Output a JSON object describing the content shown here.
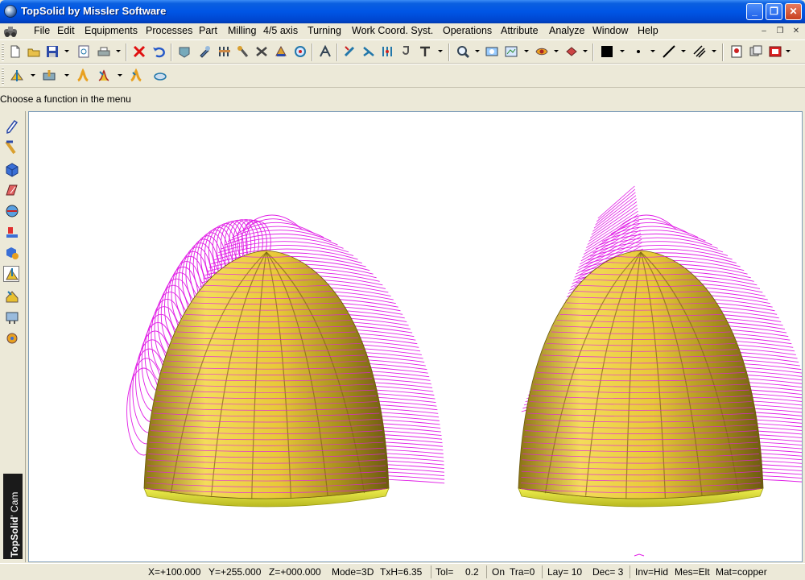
{
  "window": {
    "title": "TopSolid by Missler Software"
  },
  "menu": [
    "File",
    "Edit",
    "Equipments",
    "Processes",
    "Part",
    "Milling",
    "4/5 axis",
    "Turning",
    "Work Coord. Syst.",
    "Operations",
    "Attribute",
    "Analyze",
    "Window",
    "Help"
  ],
  "prompt": "Choose a function in the menu",
  "sidebar": {
    "brand": "TopSolid",
    "brand_suffix": "' Cam"
  },
  "status": {
    "x": "X=+100.000",
    "y": "Y=+255.000",
    "z": "Z=+000.000",
    "mode": "Mode=3D",
    "txh": "TxH=6.35",
    "tol_label": "Tol=",
    "tol_value": "0.2",
    "on": "On",
    "tra": "Tra=0",
    "lay": "Lay= 10",
    "dec": "Dec= 3",
    "inv": "Inv=Hid",
    "mes": "Mes=Elt",
    "mat": "Mat=copper"
  },
  "colors": {
    "toolpath": "#e11ee6",
    "part_light": "#f4dc5a",
    "part_mid": "#d9b934",
    "part_dark": "#8a7214",
    "base": "#e8e838",
    "titlebar": "#0055e5"
  },
  "icons": {
    "toolbar1": [
      "new-file-icon",
      "open-folder-icon",
      "save-icon",
      "print-preview-icon",
      "print-icon",
      "delete-icon",
      "undo-icon",
      "machine-icon",
      "tool-icon",
      "tool-holder-icon",
      "spindle-icon",
      "fixture-icon",
      "stock-icon",
      "simulate-icon",
      "process-icon",
      "edit-path-icon",
      "cut-path-icon",
      "link-icon",
      "hook-icon",
      "text-icon",
      "zoom-icon",
      "zoom-window-icon",
      "view-icon",
      "render-icon",
      "shade-icon",
      "color-square-icon",
      "point-style-icon",
      "line-style-icon",
      "hatch-icon",
      "doc-icon",
      "layers-icon",
      "exit-icon"
    ],
    "toolbar2": [
      "roughing-icon",
      "pocket-icon",
      "contour-icon",
      "profile-icon",
      "finishing-icon",
      "drill-icon"
    ],
    "sidebar": [
      "sketch-icon",
      "curve-icon",
      "solid-icon",
      "surface-icon",
      "assembly-icon",
      "cam-icon",
      "draft-icon",
      "milling-icon",
      "turning-icon",
      "wire-icon",
      "settings-icon"
    ]
  }
}
